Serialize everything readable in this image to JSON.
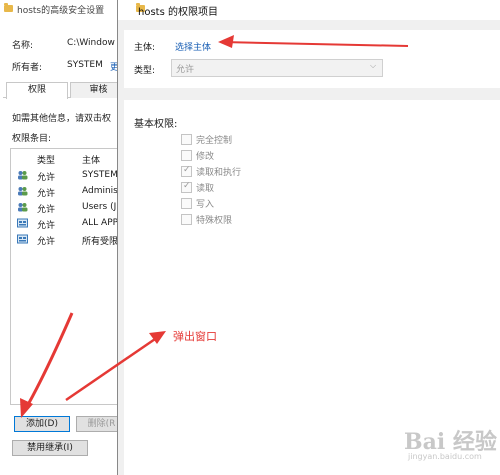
{
  "background_window": {
    "title": "hosts的高级安全设置",
    "name_label": "名称:",
    "name_value": "C:\\Window",
    "owner_label": "所有者:",
    "owner_value": "SYSTEM",
    "owner_change_link": "更",
    "tabs": [
      "权限",
      "审核"
    ],
    "hint_text": "如需其他信息，请双击权",
    "entries_label": "权限条目:",
    "columns": [
      "类型",
      "主体"
    ],
    "entries": [
      {
        "type": "允许",
        "subject": "SYSTEM",
        "icon": "group-users-icon"
      },
      {
        "type": "允许",
        "subject": "Adminis",
        "icon": "group-users-icon"
      },
      {
        "type": "允许",
        "subject": "Users (J",
        "icon": "group-users-icon"
      },
      {
        "type": "允许",
        "subject": "ALL APP",
        "icon": "app-package-icon"
      },
      {
        "type": "允许",
        "subject": "所有受限",
        "icon": "app-package-icon"
      }
    ],
    "add_button": "添加(D)",
    "remove_button": "删除(R",
    "disable_inheritance_button": "禁用继承(I)"
  },
  "dialog": {
    "title": "hosts 的权限项目",
    "subject_label": "主体:",
    "subject_link": "选择主体",
    "type_label": "类型:",
    "type_value": "允许",
    "basic_permissions_label": "基本权限:",
    "permissions": [
      {
        "label": "完全控制",
        "checked": false
      },
      {
        "label": "修改",
        "checked": false
      },
      {
        "label": "读取和执行",
        "checked": true
      },
      {
        "label": "读取",
        "checked": true
      },
      {
        "label": "写入",
        "checked": false
      },
      {
        "label": "特殊权限",
        "checked": false
      }
    ]
  },
  "annotation": {
    "popup_text": "弹出窗口",
    "color": "#e53935"
  },
  "watermark": {
    "text": "Bai 经验",
    "url": "jingyan.baidu.com"
  }
}
